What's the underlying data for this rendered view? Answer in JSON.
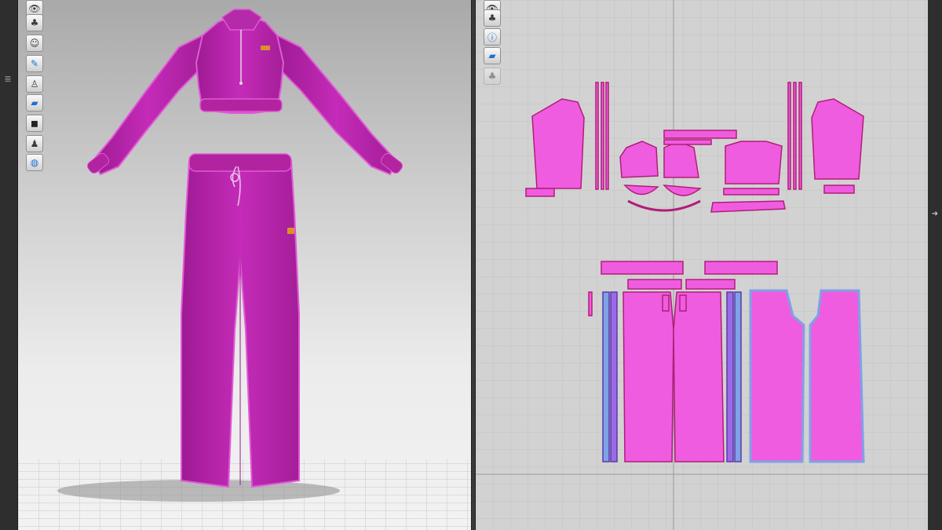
{
  "left_strip": {
    "icon": "list-icon"
  },
  "viewport3d": {
    "toolbar": [
      {
        "name": "visibility-toggle-icon"
      },
      {
        "name": "garment-display-icon"
      },
      {
        "name": "avatar-visibility-icon"
      },
      {
        "name": "texture-brush-icon"
      },
      {
        "name": "avatar-display-icon"
      },
      {
        "name": "fabric-render-icon"
      },
      {
        "name": "shaded-mode-icon"
      },
      {
        "name": "avatar-silhouette-icon"
      },
      {
        "name": "globe-environment-icon"
      }
    ],
    "garment": {
      "top": "cropped zip jacket",
      "bottom": "wide-leg track pants",
      "color": "#c42bb8"
    }
  },
  "viewport2d": {
    "toolbar": [
      {
        "name": "visibility-toggle-icon"
      },
      {
        "name": "garment-display-icon"
      },
      {
        "name": "info-icon"
      },
      {
        "name": "fabric-render-icon"
      },
      {
        "name": "disabled-tool-icon"
      }
    ],
    "pattern_color": "#f05ce0",
    "stitch_color": "#b01e78",
    "seam_highlight_color": "#7ea2e6"
  },
  "right_strip": {
    "icon": "collapse-arrow-icon"
  }
}
